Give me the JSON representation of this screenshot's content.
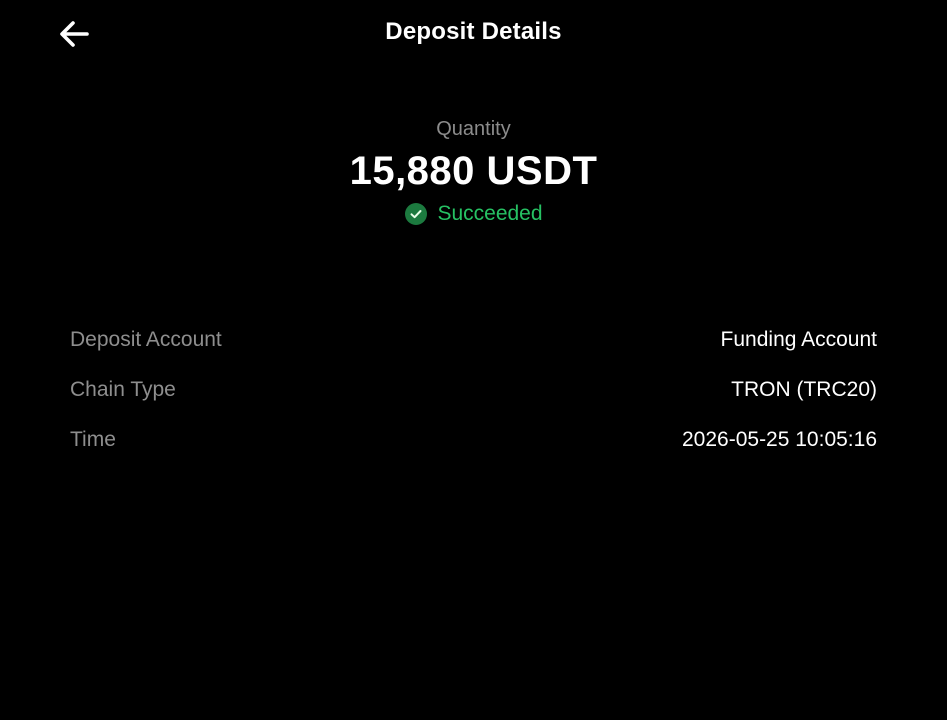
{
  "header": {
    "title": "Deposit Details",
    "back_icon": "arrow-left-icon"
  },
  "summary": {
    "quantity_label": "Quantity",
    "amount": "15,880 USDT",
    "status": "Succeeded",
    "status_icon": "check-circle-icon"
  },
  "details": [
    {
      "label": "Deposit Account",
      "value": "Funding Account"
    },
    {
      "label": "Chain Type",
      "value": "TRON (TRC20)"
    },
    {
      "label": "Time",
      "value": "2026-05-25 10:05:16"
    }
  ],
  "colors": {
    "background": "#000000",
    "text_primary": "#ffffff",
    "text_secondary": "#8e8e8e",
    "success": "#26c163"
  }
}
